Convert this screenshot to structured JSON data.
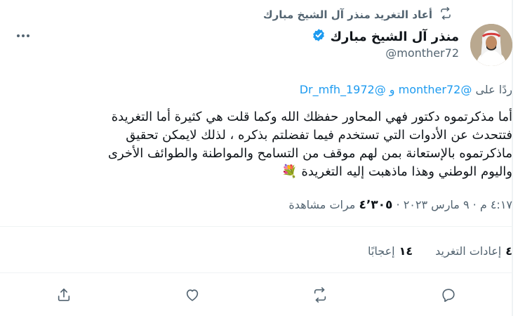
{
  "social_context": "أعاد التغريد منذر آل الشيخ مبارك",
  "author": {
    "name": "منذر آل الشيخ مبارك",
    "handle": "@monther72"
  },
  "reply_to": {
    "prefix": "ردًا على",
    "handle1": "@monther72",
    "conj": "و",
    "handle2": "@Dr_mfh_1972"
  },
  "tweet": {
    "lines": [
      "أما مذكرتموه دكتور فهي المحاور حفظك الله وكما قلت هي كثيرة أما التغريدة",
      "فتتحدث عن الأدوات التي تستخدم فيما تفضلتم بذكره ، لذلك لايمكن تحقيق",
      "ماذكرتموه بالإستعانة بمن لهم موقف من التسامح والمواطنة والطوائف الأخرى",
      "واليوم الوطني وهذا ماذهبت إليه التغريدة 💐"
    ]
  },
  "meta": {
    "time": "٤:١٧ م",
    "sep": "·",
    "date": "٩ مارس ٢٠٢٣",
    "views_count": "٤٬٣٠٥",
    "views_label": "مرات مشاهدة"
  },
  "stats": {
    "retweets_count": "٤",
    "retweets_label": "إعادات التغريد",
    "likes_count": "١٤",
    "likes_label": "إعجابًا"
  },
  "colors": {
    "accent": "#1d9bf0",
    "secondary_text": "#536471",
    "divider": "#eff3f4"
  },
  "icons": [
    "retweet-icon",
    "verified-badge-icon",
    "more-icon",
    "reply-icon",
    "like-icon",
    "share-icon"
  ]
}
